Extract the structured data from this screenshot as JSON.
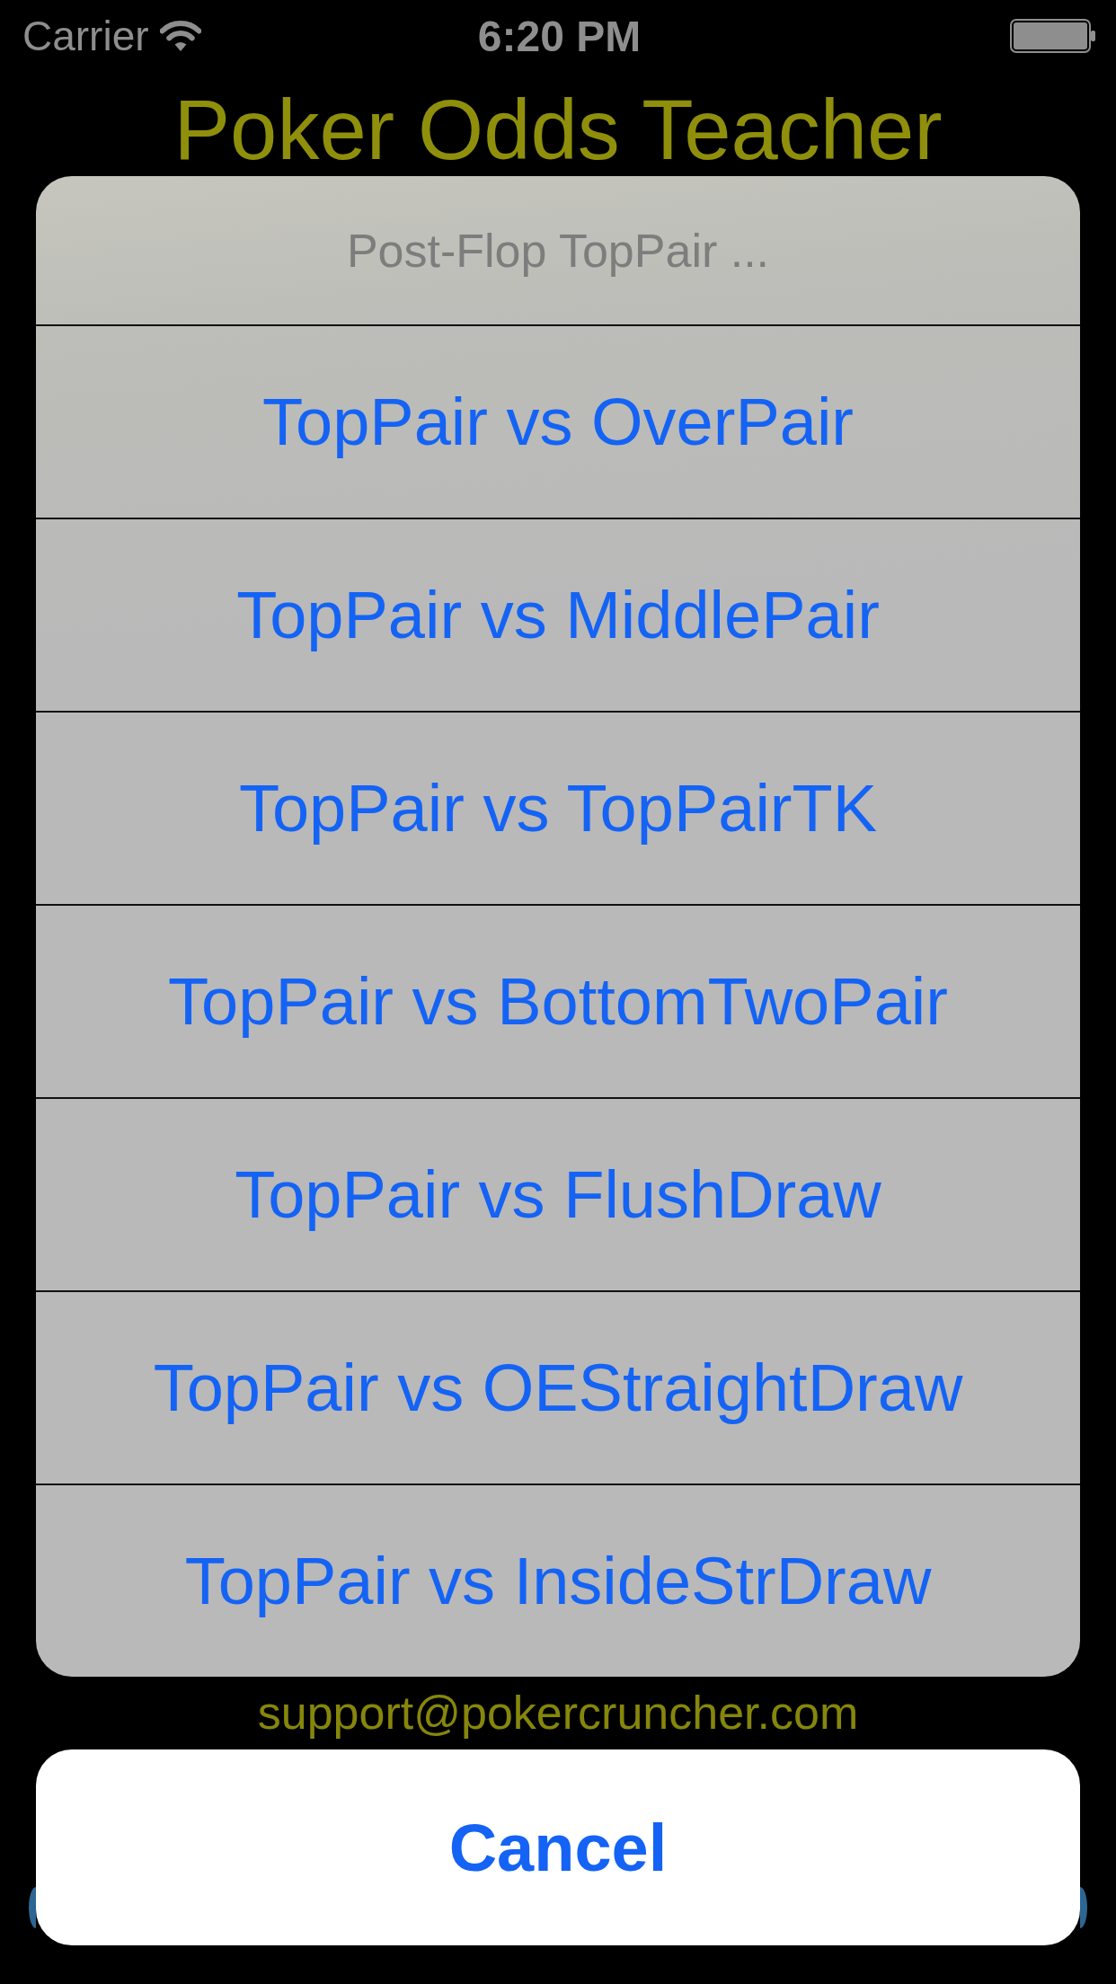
{
  "status_bar": {
    "carrier": "Carrier",
    "time": "6:20 PM"
  },
  "background": {
    "title": "Poker Odds Teacher",
    "email": "support@pokercruncher.com"
  },
  "action_sheet": {
    "title": "Post-Flop TopPair ...",
    "actions": [
      "TopPair vs OverPair",
      "TopPair vs MiddlePair",
      "TopPair vs TopPairTK",
      "TopPair vs BottomTwoPair",
      "TopPair vs FlushDraw",
      "TopPair vs OEStraightDraw",
      "TopPair vs InsideStrDraw"
    ],
    "cancel": "Cancel"
  }
}
